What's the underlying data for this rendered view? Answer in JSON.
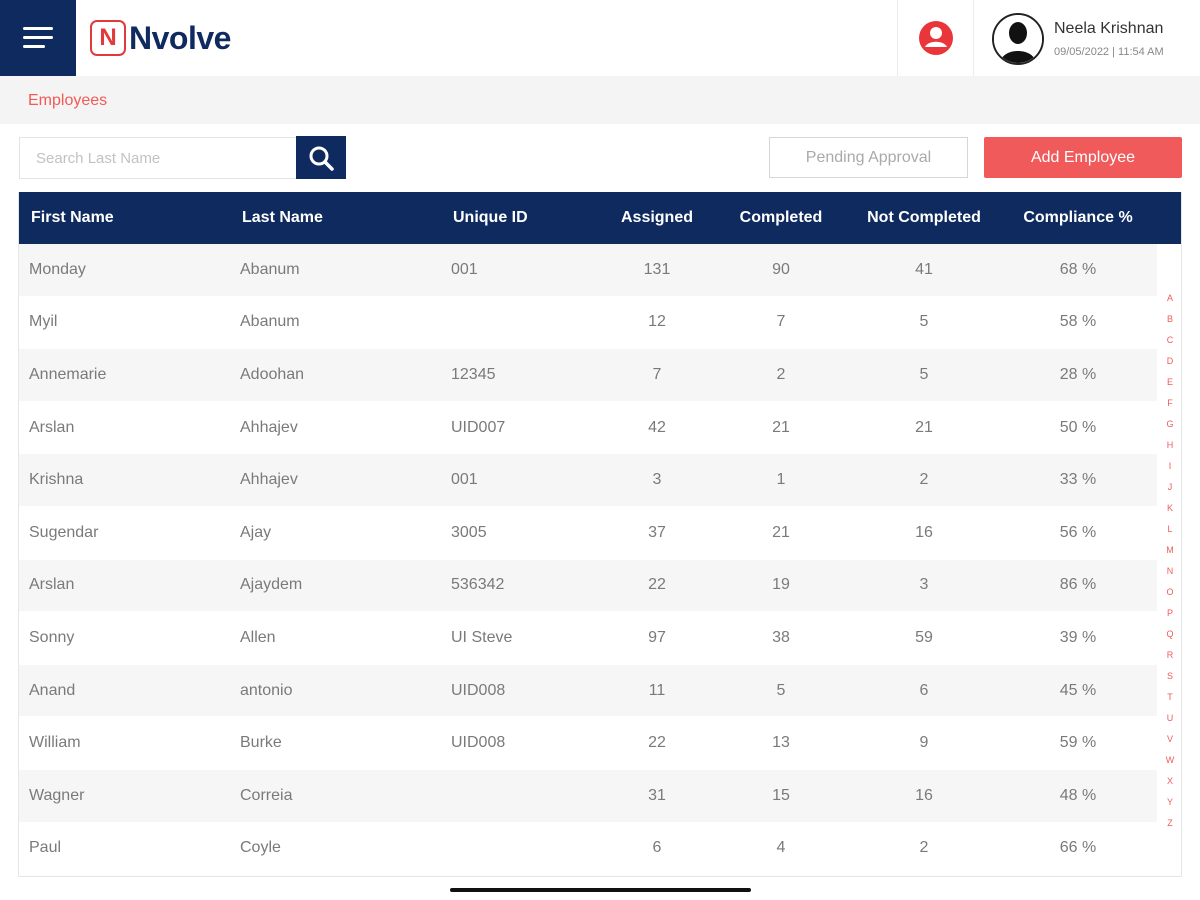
{
  "header": {
    "logo_letter": "N",
    "logo_text": "Nvolve",
    "user_name": "Neela Krishnan",
    "user_datetime": "09/05/2022 | 11:54 AM"
  },
  "breadcrumb": "Employees",
  "search": {
    "placeholder": "Search Last Name"
  },
  "buttons": {
    "pending": "Pending Approval",
    "add": "Add Employee"
  },
  "table": {
    "headers": [
      "First Name",
      "Last Name",
      "Unique ID",
      "Assigned",
      "Completed",
      "Not Completed",
      "Compliance %"
    ],
    "rows": [
      [
        "Monday",
        "Abanum",
        "001",
        "131",
        "90",
        "41",
        "68 %"
      ],
      [
        "Myil",
        "Abanum",
        "",
        "12",
        "7",
        "5",
        "58 %"
      ],
      [
        "Annemarie",
        "Adoohan",
        "12345",
        "7",
        "2",
        "5",
        "28 %"
      ],
      [
        "Arslan",
        "Ahhajev",
        "UID007",
        "42",
        "21",
        "21",
        "50 %"
      ],
      [
        "Krishna",
        "Ahhajev",
        "001",
        "3",
        "1",
        "2",
        "33 %"
      ],
      [
        "Sugendar",
        "Ajay",
        "3005",
        "37",
        "21",
        "16",
        "56 %"
      ],
      [
        "Arslan",
        "Ajaydem",
        "536342",
        "22",
        "19",
        "3",
        "86 %"
      ],
      [
        "Sonny",
        "Allen",
        "UI Steve",
        "97",
        "38",
        "59",
        "39 %"
      ],
      [
        "Anand",
        "antonio",
        "UID008",
        "11",
        "5",
        "6",
        "45 %"
      ],
      [
        "William",
        "Burke",
        "UID008",
        "22",
        "13",
        "9",
        "59 %"
      ],
      [
        "Wagner",
        "Correia",
        "",
        "31",
        "15",
        "16",
        "48 %"
      ],
      [
        "Paul",
        "Coyle",
        "",
        "6",
        "4",
        "2",
        "66 %"
      ]
    ]
  },
  "alphabet": [
    "A",
    "B",
    "C",
    "D",
    "E",
    "F",
    "G",
    "H",
    "I",
    "J",
    "K",
    "L",
    "M",
    "N",
    "O",
    "P",
    "Q",
    "R",
    "S",
    "T",
    "U",
    "V",
    "W",
    "X",
    "Y",
    "Z"
  ],
  "colors": {
    "navy": "#0f2a5f",
    "accent": "#f05a5a"
  },
  "icons": {
    "menu": "hamburger-icon",
    "search": "search-icon",
    "profile": "user-circle-icon",
    "avatar": "user-silhouette-icon"
  }
}
